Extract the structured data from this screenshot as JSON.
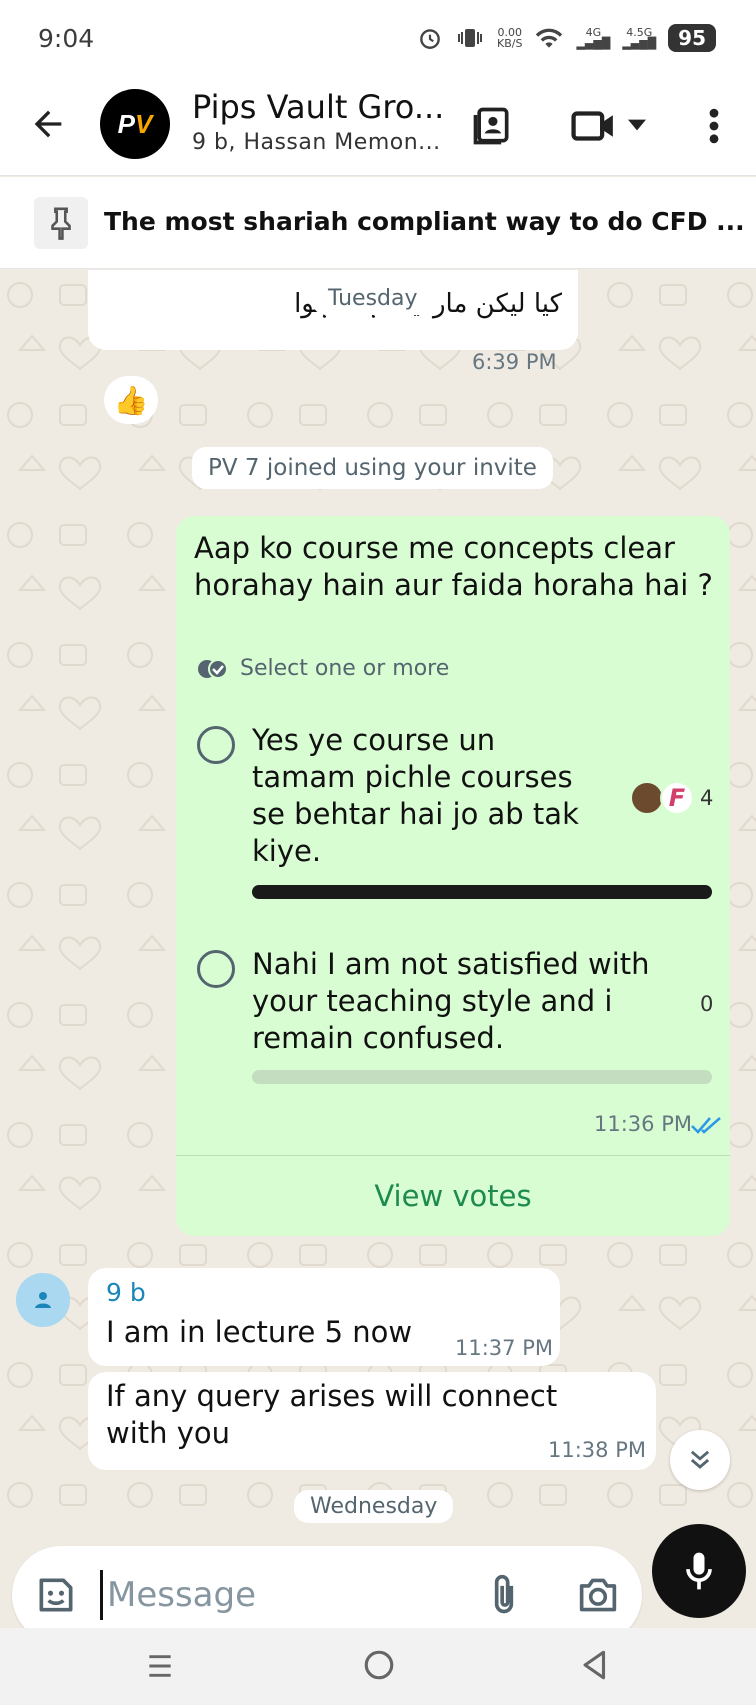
{
  "status_bar": {
    "time": "9:04",
    "net_speed_top": "0.00",
    "net_speed_bottom": "KB/S",
    "net1": "4G",
    "net2": "4.5G",
    "battery": "95"
  },
  "header": {
    "group_name": "Pips Vault Gro...",
    "members": "9 b, Hassan Memon...",
    "logo_text_white": "P",
    "logo_text_orange": "V"
  },
  "pinned": {
    "text": "The most shariah compliant way to do CFD ..."
  },
  "messages": {
    "urdu_text": "کیا لیکن مارکیٹ ہٹ ہوا",
    "day_tuesday": "Tuesday",
    "urdu_time": "6:39 PM",
    "reaction": "👍",
    "system_notice": "PV 7 joined using your invite",
    "poll": {
      "question": "Aap ko course me concepts clear horahay hain aur faida horaha hai ?",
      "hint": "Select one or more",
      "options": [
        {
          "text": "Yes ye course un tamam pichle courses se behtar hai jo ab tak kiye.",
          "votes": "4",
          "fraction": 1.0
        },
        {
          "text": "Nahi I am not satisfied with your teaching style and i remain confused.",
          "votes": "0",
          "fraction": 0.0
        }
      ],
      "voter_initial": "F",
      "time": "11:36 PM",
      "view_votes": "View votes"
    },
    "incoming1": {
      "sender": "9 b",
      "text": "I am in lecture 5 now",
      "time": "11:37 PM"
    },
    "incoming2": {
      "text": "If any query arises will connect with you",
      "time": "11:38 PM"
    },
    "day_wednesday": "Wednesday"
  },
  "composer": {
    "placeholder": "Message"
  },
  "colors": {
    "out_bubble": "#d9fdd3",
    "accent_green": "#1d8a4f",
    "sender_blue": "#1b86b9"
  }
}
